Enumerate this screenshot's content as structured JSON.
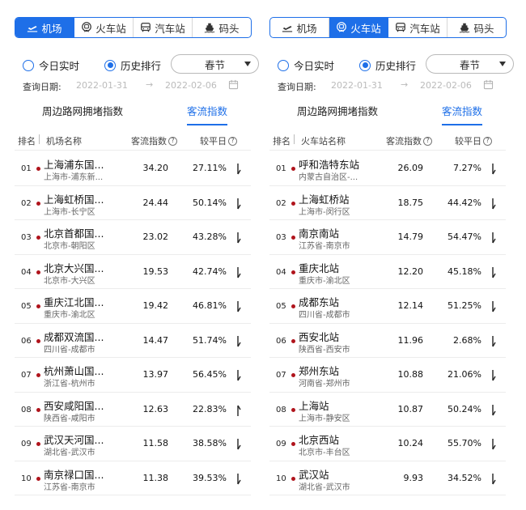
{
  "panels": [
    {
      "active_tab": 0,
      "tabs": [
        {
          "label": "机场",
          "icon": "plane-icon"
        },
        {
          "label": "火车站",
          "icon": "train-icon"
        },
        {
          "label": "汽车站",
          "icon": "bus-icon"
        },
        {
          "label": "码头",
          "icon": "ship-icon"
        }
      ],
      "radio_realtime": "今日实时",
      "radio_history": "历史排行",
      "select_value": "春节",
      "date_label": "查询日期:",
      "date_from": "2022-01-31",
      "date_arrow": "→",
      "date_to": "2022-02-06",
      "subtab_congestion": "周边路网拥堵指数",
      "subtab_passenger": "客流指数",
      "col_rank": "排名",
      "col_name": "机场名称",
      "col_index": "客流指数",
      "col_compare": "较平日",
      "rows": [
        {
          "rank": "01",
          "name": "上海浦东国...",
          "loc": "上海市-浦东新...",
          "index": "34.20",
          "pct": "27.11%",
          "trend": "down"
        },
        {
          "rank": "02",
          "name": "上海虹桥国...",
          "loc": "上海市-长宁区",
          "index": "24.44",
          "pct": "50.14%",
          "trend": "down"
        },
        {
          "rank": "03",
          "name": "北京首都国...",
          "loc": "北京市-朝阳区",
          "index": "23.02",
          "pct": "43.28%",
          "trend": "down"
        },
        {
          "rank": "04",
          "name": "北京大兴国...",
          "loc": "北京市-大兴区",
          "index": "19.53",
          "pct": "42.74%",
          "trend": "down"
        },
        {
          "rank": "05",
          "name": "重庆江北国...",
          "loc": "重庆市-渝北区",
          "index": "19.42",
          "pct": "46.81%",
          "trend": "down"
        },
        {
          "rank": "06",
          "name": "成都双流国...",
          "loc": "四川省-成都市",
          "index": "14.47",
          "pct": "51.74%",
          "trend": "down"
        },
        {
          "rank": "07",
          "name": "杭州萧山国...",
          "loc": "浙江省-杭州市",
          "index": "13.97",
          "pct": "56.45%",
          "trend": "down"
        },
        {
          "rank": "08",
          "name": "西安咸阳国...",
          "loc": "陕西省-咸阳市",
          "index": "12.63",
          "pct": "22.83%",
          "trend": "up"
        },
        {
          "rank": "09",
          "name": "武汉天河国...",
          "loc": "湖北省-武汉市",
          "index": "11.58",
          "pct": "38.58%",
          "trend": "down"
        },
        {
          "rank": "10",
          "name": "南京禄口国...",
          "loc": "江苏省-南京市",
          "index": "11.38",
          "pct": "39.53%",
          "trend": "down"
        }
      ]
    },
    {
      "active_tab": 1,
      "tabs": [
        {
          "label": "机场",
          "icon": "plane-icon"
        },
        {
          "label": "火车站",
          "icon": "train-icon"
        },
        {
          "label": "汽车站",
          "icon": "bus-icon"
        },
        {
          "label": "码头",
          "icon": "ship-icon"
        }
      ],
      "radio_realtime": "今日实时",
      "radio_history": "历史排行",
      "select_value": "春节",
      "date_label": "查询日期:",
      "date_from": "2022-01-31",
      "date_arrow": "→",
      "date_to": "2022-02-06",
      "subtab_congestion": "周边路网拥堵指数",
      "subtab_passenger": "客流指数",
      "col_rank": "排名",
      "col_name": "火车站名称",
      "col_index": "客流指数",
      "col_compare": "较平日",
      "rows": [
        {
          "rank": "01",
          "name": "呼和浩特东站",
          "loc": "内蒙古自治区-...",
          "index": "26.09",
          "pct": "7.27%",
          "trend": "down"
        },
        {
          "rank": "02",
          "name": "上海虹桥站",
          "loc": "上海市-闵行区",
          "index": "18.75",
          "pct": "44.42%",
          "trend": "down"
        },
        {
          "rank": "03",
          "name": "南京南站",
          "loc": "江苏省-南京市",
          "index": "14.79",
          "pct": "54.47%",
          "trend": "down"
        },
        {
          "rank": "04",
          "name": "重庆北站",
          "loc": "重庆市-渝北区",
          "index": "12.20",
          "pct": "45.18%",
          "trend": "down"
        },
        {
          "rank": "05",
          "name": "成都东站",
          "loc": "四川省-成都市",
          "index": "12.14",
          "pct": "51.25%",
          "trend": "down"
        },
        {
          "rank": "06",
          "name": "西安北站",
          "loc": "陕西省-西安市",
          "index": "11.96",
          "pct": "2.68%",
          "trend": "down"
        },
        {
          "rank": "07",
          "name": "郑州东站",
          "loc": "河南省-郑州市",
          "index": "10.88",
          "pct": "21.06%",
          "trend": "down"
        },
        {
          "rank": "08",
          "name": "上海站",
          "loc": "上海市-静安区",
          "index": "10.87",
          "pct": "50.24%",
          "trend": "down"
        },
        {
          "rank": "09",
          "name": "北京西站",
          "loc": "北京市-丰台区",
          "index": "10.24",
          "pct": "55.70%",
          "trend": "down"
        },
        {
          "rank": "10",
          "name": "武汉站",
          "loc": "湖北省-武汉市",
          "index": "9.93",
          "pct": "34.52%",
          "trend": "down"
        }
      ]
    }
  ],
  "colors": {
    "accent": "#1e6fe8",
    "rank_dot": "#b0141c"
  }
}
